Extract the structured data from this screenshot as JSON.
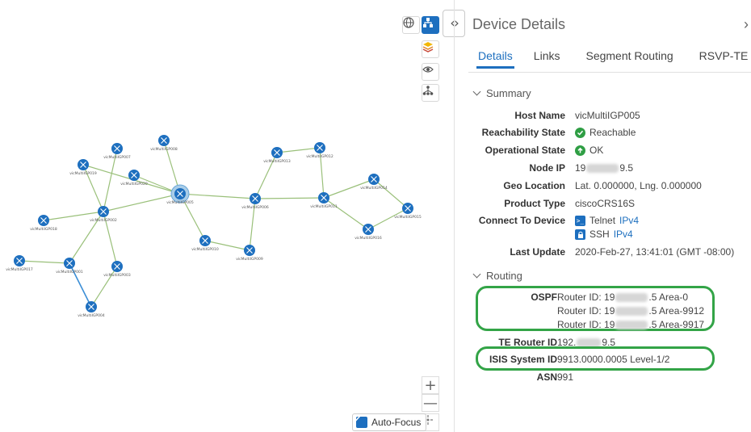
{
  "map": {
    "nodes": [
      {
        "id": "vicMultiIGP001",
        "label": "vicMultiIGP001"
      },
      {
        "id": "vicMultiIGP002",
        "label": "vicMultiIGP002"
      },
      {
        "id": "vicMultiIGP003",
        "label": "vicMultiIGP003"
      },
      {
        "id": "vicMultiIGP004",
        "label": "vicMultiIGP004"
      },
      {
        "id": "vicMultiIGP005",
        "label": "vicMultiIGP005"
      },
      {
        "id": "vicMultiIGP006",
        "label": "vicMultiIGP006"
      },
      {
        "id": "vicMultiIGP007",
        "label": "vicMultiIGP007"
      },
      {
        "id": "vicMultiIGP008",
        "label": "vicMultiIGP008"
      },
      {
        "id": "vicMultiIGP009",
        "label": "vicMultiIGP009"
      },
      {
        "id": "vicMultiIGP010",
        "label": "vicMultiIGP010"
      },
      {
        "id": "vicMultiIGP011",
        "label": "vicMultiIGP011"
      },
      {
        "id": "vicMultiIGP012",
        "label": "vicMultiIGP012"
      },
      {
        "id": "vicMultiIGP013",
        "label": "vicMultiIGP013"
      },
      {
        "id": "vicMultiIGP014",
        "label": "vicMultiIGP014"
      },
      {
        "id": "vicMultiIGP015",
        "label": "vicMultiIGP015"
      },
      {
        "id": "vicMultiIGP016",
        "label": "vicMultiIGP016"
      },
      {
        "id": "vicMultiIGP017",
        "label": "vicMultiIGP017"
      },
      {
        "id": "vicMultiIGP018",
        "label": "vicMultiIGP018"
      },
      {
        "id": "vicMultiIGP019",
        "label": "vicMultiIGP019"
      },
      {
        "id": "vicMultiIGP020",
        "label": "vicMultiIGP020"
      }
    ],
    "links": [
      [
        "vicMultiIGP005",
        "vicMultiIGP006"
      ],
      [
        "vicMultiIGP005",
        "vicMultiIGP002"
      ],
      [
        "vicMultiIGP005",
        "vicMultiIGP020"
      ],
      [
        "vicMultiIGP005",
        "vicMultiIGP008"
      ],
      [
        "vicMultiIGP005",
        "vicMultiIGP010"
      ],
      [
        "vicMultiIGP005",
        "vicMultiIGP019"
      ],
      [
        "vicMultiIGP002",
        "vicMultiIGP007"
      ],
      [
        "vicMultiIGP002",
        "vicMultiIGP018"
      ],
      [
        "vicMultiIGP002",
        "vicMultiIGP001"
      ],
      [
        "vicMultiIGP002",
        "vicMultiIGP003"
      ],
      [
        "vicMultiIGP002",
        "vicMultiIGP019"
      ],
      [
        "vicMultiIGP001",
        "vicMultiIGP017"
      ],
      [
        "vicMultiIGP003",
        "vicMultiIGP004"
      ],
      [
        "vicMultiIGP006",
        "vicMultiIGP009"
      ],
      [
        "vicMultiIGP006",
        "vicMultiIGP013"
      ],
      [
        "vicMultiIGP006",
        "vicMultiIGP011"
      ],
      [
        "vicMultiIGP013",
        "vicMultiIGP012"
      ],
      [
        "vicMultiIGP012",
        "vicMultiIGP011"
      ],
      [
        "vicMultiIGP011",
        "vicMultiIGP014"
      ],
      [
        "vicMultiIGP011",
        "vicMultiIGP016"
      ],
      [
        "vicMultiIGP014",
        "vicMultiIGP015"
      ],
      [
        "vicMultiIGP016",
        "vicMultiIGP015"
      ],
      [
        "vicMultiIGP010",
        "vicMultiIGP009"
      ]
    ],
    "highlighted_link": [
      "vicMultiIGP001",
      "vicMultiIGP004"
    ],
    "selected_node": "vicMultiIGP005",
    "toolbar": [
      "globe-icon",
      "topology-icon",
      "layers-icon",
      "eye-icon",
      "hierarchy-icon"
    ],
    "zoom_in": "+",
    "zoom_out": "—",
    "auto_focus_label": "Auto-Focus",
    "auto_focus_checked": true,
    "colors": {
      "link": "#9ac07a",
      "highlight_link": "#3d8fd6",
      "node": "#1d6fbf"
    }
  },
  "panel": {
    "title": "Device Details",
    "close": "›",
    "tabs": [
      "Details",
      "Links",
      "Segment Routing",
      "RSVP-TE"
    ],
    "active_tab": "Details",
    "summary": {
      "heading": "Summary",
      "host_name_label": "Host Name",
      "host_name": "vicMultiIGP005",
      "reachability_label": "Reachability State",
      "reachability": "Reachable",
      "operational_label": "Operational State",
      "operational": "OK",
      "node_ip_label": "Node IP",
      "node_ip_prefix": "19",
      "node_ip_suffix": "9.5",
      "geo_label": "Geo Location",
      "geo": "Lat. 0.000000, Lng. 0.000000",
      "product_label": "Product Type",
      "product": "ciscoCRS16S",
      "connect_label": "Connect To Device",
      "telnet": "Telnet",
      "telnet_proto": "IPv4",
      "ssh": "SSH",
      "ssh_proto": "IPv4",
      "last_update_label": "Last Update",
      "last_update": "2020-Feb-27, 13:41:01 (GMT -08:00)"
    },
    "routing": {
      "heading": "Routing",
      "ospf_label": "OSPF",
      "ospf_prefix": "Router ID: 19",
      "ospf_suffixes": [
        ".5 Area-0",
        ".5 Area-9912",
        ".5 Area-9917"
      ],
      "te_label": "TE Router ID",
      "te_prefix": "192.",
      "te_suffix": "9.5",
      "isis_label": "ISIS System ID",
      "isis": "9913.0000.0005 Level-1/2",
      "asn_label": "ASN",
      "asn": "991"
    },
    "highlight_color": "#33a447"
  }
}
